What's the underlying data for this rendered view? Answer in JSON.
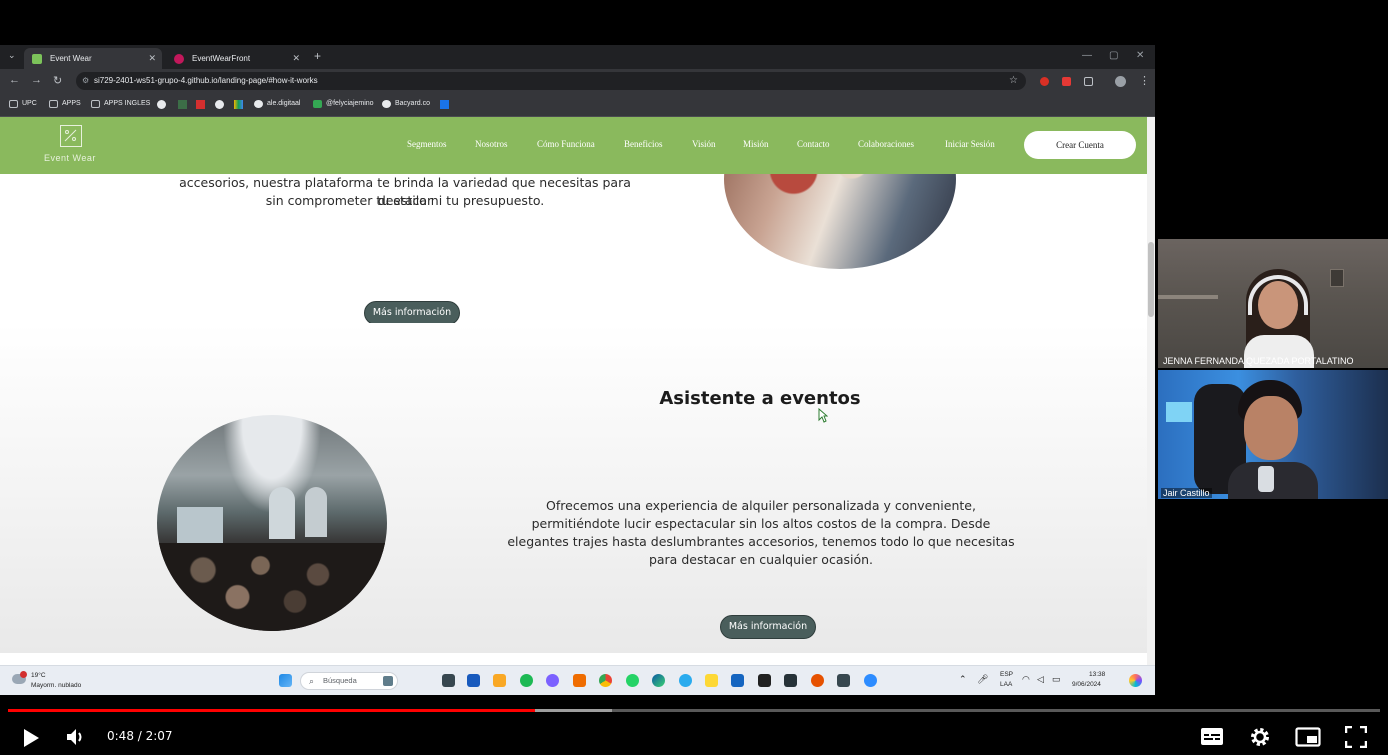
{
  "browser": {
    "tabs": [
      {
        "label": "Event Wear",
        "active": true,
        "color": "#7cc35a"
      },
      {
        "label": "EventWearFront",
        "active": false,
        "color": "#c2185b"
      }
    ],
    "url": "si729-2401-ws51-grupo-4.github.io/landing-page/#how-it-works",
    "bookmarks": [
      "UPC",
      "APPS",
      "APPS INGLES",
      "ale.digitaal",
      "@felyciajemino",
      "Bacyard.co"
    ]
  },
  "site": {
    "logo_text": "Event Wear",
    "nav": [
      "Segmentos",
      "Nosotros",
      "Cómo Funciona",
      "Beneficios",
      "Visión",
      "Misión",
      "Contacto",
      "Colaboraciones",
      "Iniciar Sesión"
    ],
    "cta": "Crear Cuenta",
    "accent": "#8ab95d",
    "section1": {
      "text_line1": "accesorios, nuestra plataforma te brinda la variedad que necesitas para destacar",
      "text_line2": "sin comprometer tu estilo ni tu presupuesto.",
      "button": "Más información"
    },
    "section2": {
      "title": "Asistente a eventos",
      "text_lines": [
        "Ofrecemos una experiencia de alquiler personalizada y conveniente,",
        "permitiéndote lucir espectacular sin los altos costos de la compra. Desde",
        "elegantes trajes hasta deslumbrantes accesorios, tenemos todo lo que necesitas",
        "para destacar en cualquier ocasión."
      ],
      "button": "Más información"
    }
  },
  "taskbar": {
    "weather_temp": "19°C",
    "weather_desc": "Mayorm. nublado",
    "search_placeholder": "Búsqueda",
    "lang_top": "ESP",
    "lang_bottom": "LAA",
    "time": "13:38",
    "date": "9/06/2024"
  },
  "participants": [
    {
      "name": "JENNA FERNANDA QUEZADA PORTALATINO"
    },
    {
      "name": "Jair Castillo"
    }
  ],
  "player": {
    "time_display": "0:48 / 2:07",
    "progress_fraction": 0.384,
    "buffered_fraction": 0.44
  }
}
